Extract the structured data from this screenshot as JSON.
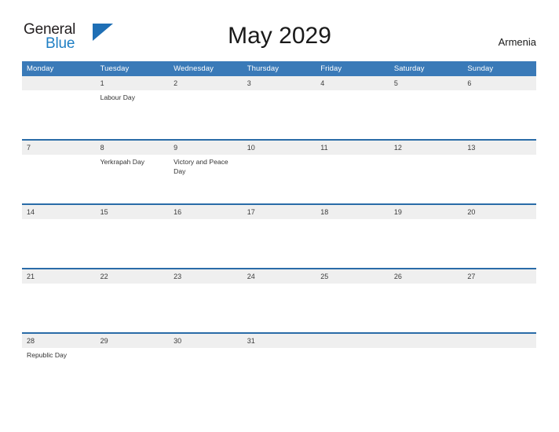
{
  "brand": {
    "name_part1": "General",
    "name_part2": "Blue",
    "color_dark": "#231f20",
    "color_blue": "#1f7fc4"
  },
  "header": {
    "title": "May 2029",
    "country": "Armenia"
  },
  "theme": {
    "header_blue": "#3a7ab8",
    "rule_blue": "#2a6ca8",
    "date_band_gray": "#efefef",
    "text_dark": "#333333"
  },
  "calendar": {
    "month": "May",
    "year": "2029",
    "weekdays": [
      "Monday",
      "Tuesday",
      "Wednesday",
      "Thursday",
      "Friday",
      "Saturday",
      "Sunday"
    ],
    "weeks": [
      {
        "dates": [
          "",
          "1",
          "2",
          "3",
          "4",
          "5",
          "6"
        ],
        "events": [
          "",
          "Labour Day",
          "",
          "",
          "",
          "",
          ""
        ]
      },
      {
        "dates": [
          "7",
          "8",
          "9",
          "10",
          "11",
          "12",
          "13"
        ],
        "events": [
          "",
          "Yerkrapah Day",
          "Victory and Peace Day",
          "",
          "",
          "",
          ""
        ]
      },
      {
        "dates": [
          "14",
          "15",
          "16",
          "17",
          "18",
          "19",
          "20"
        ],
        "events": [
          "",
          "",
          "",
          "",
          "",
          "",
          ""
        ]
      },
      {
        "dates": [
          "21",
          "22",
          "23",
          "24",
          "25",
          "26",
          "27"
        ],
        "events": [
          "",
          "",
          "",
          "",
          "",
          "",
          ""
        ]
      },
      {
        "dates": [
          "28",
          "29",
          "30",
          "31",
          "",
          "",
          ""
        ],
        "events": [
          "Republic Day",
          "",
          "",
          "",
          "",
          "",
          ""
        ]
      }
    ]
  }
}
